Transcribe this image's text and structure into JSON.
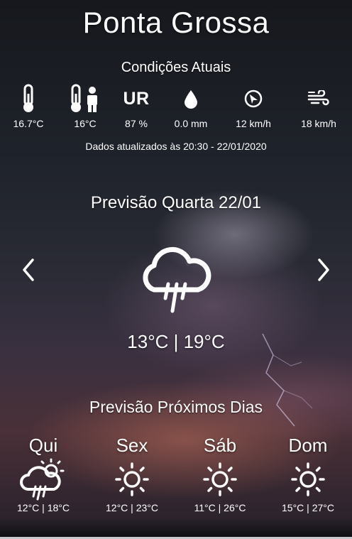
{
  "city": "Ponta Grossa",
  "current": {
    "title": "Condições Atuais",
    "items": [
      {
        "icon": "thermometer-icon",
        "value": "16.7°C"
      },
      {
        "icon": "feels-like-icon",
        "value": "16°C"
      },
      {
        "icon": "humidity-icon",
        "label": "UR",
        "value": "87 %"
      },
      {
        "icon": "raindrop-icon",
        "value": "0.0 mm"
      },
      {
        "icon": "wind-direction-icon",
        "value": "12 km/h"
      },
      {
        "icon": "wind-gust-icon",
        "value": "18 km/h"
      }
    ],
    "updated": "Dados atualizados às 20:30 - 22/01/2020"
  },
  "forecast": {
    "title": "Previsão Quarta 22/01",
    "icon": "cloud-rain-moon-icon",
    "temps": "13°C | 19°C",
    "prev_icon": "chevron-left-icon",
    "next_icon": "chevron-right-icon"
  },
  "next_days": {
    "title": "Previsão Próximos Dias",
    "days": [
      {
        "name": "Qui",
        "icon": "cloud-rain-sun-icon",
        "temps": "12°C | 18°C"
      },
      {
        "name": "Sex",
        "icon": "sun-icon",
        "temps": "12°C | 23°C"
      },
      {
        "name": "Sáb",
        "icon": "sun-icon",
        "temps": "11°C | 26°C"
      },
      {
        "name": "Dom",
        "icon": "sun-icon",
        "temps": "15°C | 27°C"
      }
    ]
  }
}
